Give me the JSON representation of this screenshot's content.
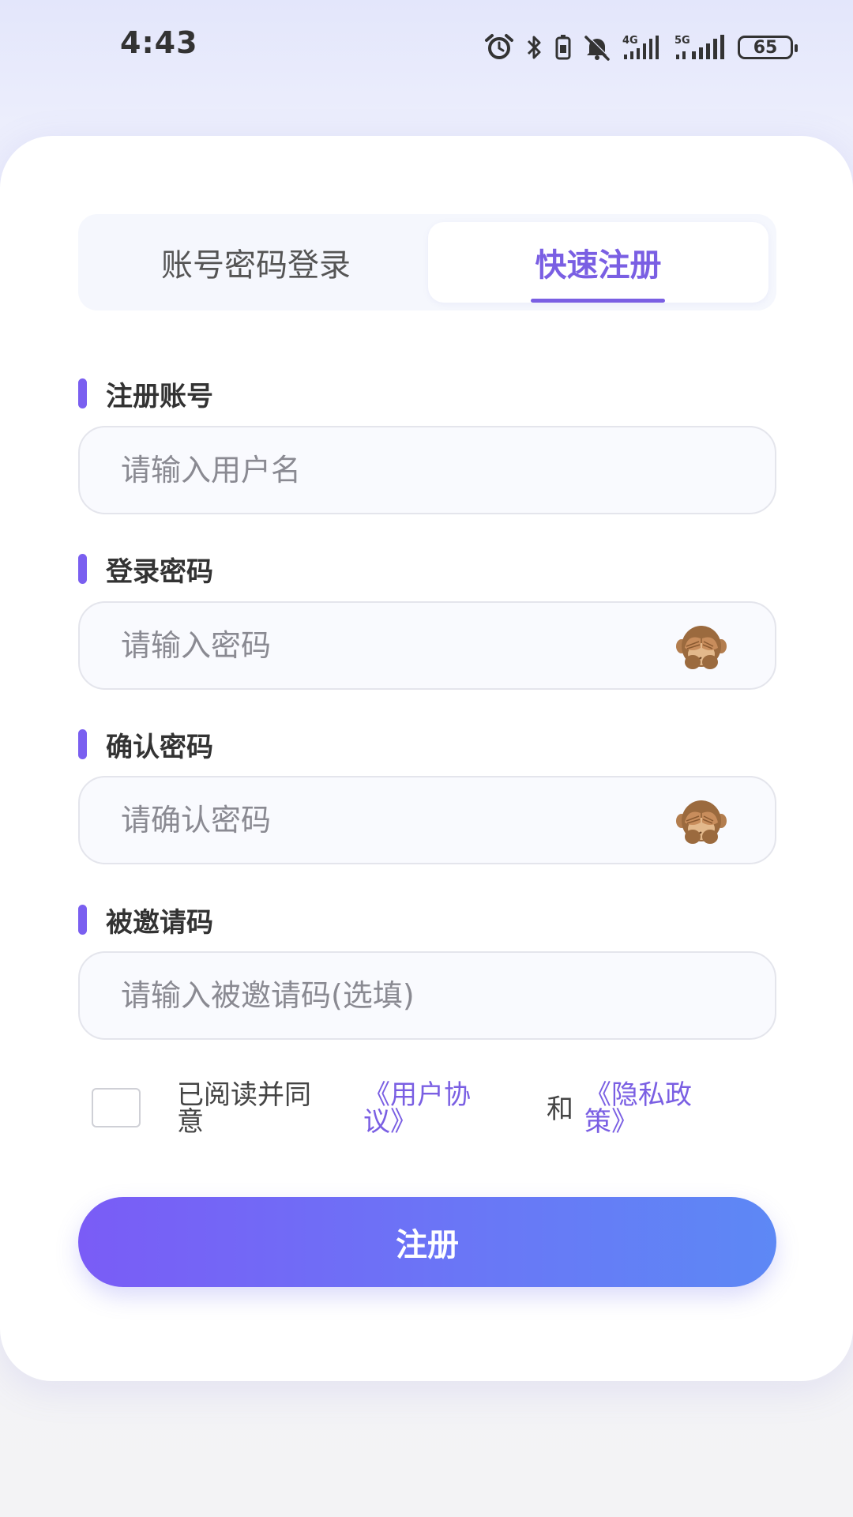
{
  "status_bar": {
    "time": "4:43",
    "icons": [
      "alarm-icon",
      "bluetooth-icon",
      "vibrate-icon",
      "mute-icon",
      "signal-4g-icon",
      "signal-5g-icon"
    ],
    "battery_level": "65"
  },
  "tabs": [
    {
      "label": "账号密码登录",
      "active": false
    },
    {
      "label": "快速注册",
      "active": true
    }
  ],
  "form": {
    "username": {
      "label": "注册账号",
      "placeholder": "请输入用户名",
      "value": ""
    },
    "password": {
      "label": "登录密码",
      "placeholder": "请输入密码",
      "value": "",
      "toggle_icon": "see-no-evil-monkey-icon"
    },
    "confirm_password": {
      "label": "确认密码",
      "placeholder": "请确认密码",
      "value": "",
      "toggle_icon": "see-no-evil-monkey-icon"
    },
    "invite_code": {
      "label": "被邀请码",
      "placeholder": "请输入被邀请码(选填)",
      "value": ""
    }
  },
  "agreement": {
    "checked": false,
    "prefix": "已阅读并同意",
    "user_agreement": "《用户协议》",
    "and": "和",
    "privacy_policy": "《隐私政策》"
  },
  "submit_label": "注册",
  "colors": {
    "accent": "#7a5fe3",
    "gradient_start": "#7a5cf6",
    "gradient_end": "#5d88f5"
  }
}
